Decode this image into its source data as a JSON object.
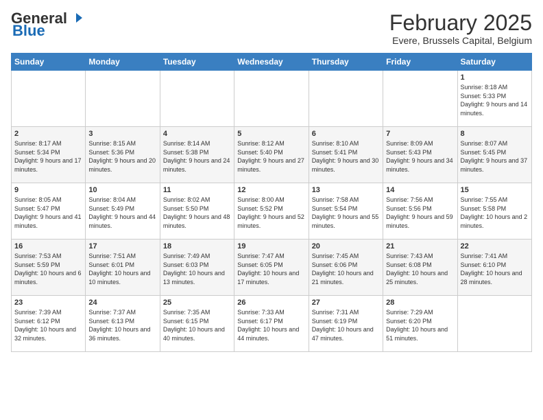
{
  "logo": {
    "general": "General",
    "blue": "Blue"
  },
  "header": {
    "month": "February 2025",
    "location": "Evere, Brussels Capital, Belgium"
  },
  "weekdays": [
    "Sunday",
    "Monday",
    "Tuesday",
    "Wednesday",
    "Thursday",
    "Friday",
    "Saturday"
  ],
  "weeks": [
    [
      {
        "day": "",
        "info": ""
      },
      {
        "day": "",
        "info": ""
      },
      {
        "day": "",
        "info": ""
      },
      {
        "day": "",
        "info": ""
      },
      {
        "day": "",
        "info": ""
      },
      {
        "day": "",
        "info": ""
      },
      {
        "day": "1",
        "info": "Sunrise: 8:18 AM\nSunset: 5:33 PM\nDaylight: 9 hours and 14 minutes."
      }
    ],
    [
      {
        "day": "2",
        "info": "Sunrise: 8:17 AM\nSunset: 5:34 PM\nDaylight: 9 hours and 17 minutes."
      },
      {
        "day": "3",
        "info": "Sunrise: 8:15 AM\nSunset: 5:36 PM\nDaylight: 9 hours and 20 minutes."
      },
      {
        "day": "4",
        "info": "Sunrise: 8:14 AM\nSunset: 5:38 PM\nDaylight: 9 hours and 24 minutes."
      },
      {
        "day": "5",
        "info": "Sunrise: 8:12 AM\nSunset: 5:40 PM\nDaylight: 9 hours and 27 minutes."
      },
      {
        "day": "6",
        "info": "Sunrise: 8:10 AM\nSunset: 5:41 PM\nDaylight: 9 hours and 30 minutes."
      },
      {
        "day": "7",
        "info": "Sunrise: 8:09 AM\nSunset: 5:43 PM\nDaylight: 9 hours and 34 minutes."
      },
      {
        "day": "8",
        "info": "Sunrise: 8:07 AM\nSunset: 5:45 PM\nDaylight: 9 hours and 37 minutes."
      }
    ],
    [
      {
        "day": "9",
        "info": "Sunrise: 8:05 AM\nSunset: 5:47 PM\nDaylight: 9 hours and 41 minutes."
      },
      {
        "day": "10",
        "info": "Sunrise: 8:04 AM\nSunset: 5:49 PM\nDaylight: 9 hours and 44 minutes."
      },
      {
        "day": "11",
        "info": "Sunrise: 8:02 AM\nSunset: 5:50 PM\nDaylight: 9 hours and 48 minutes."
      },
      {
        "day": "12",
        "info": "Sunrise: 8:00 AM\nSunset: 5:52 PM\nDaylight: 9 hours and 52 minutes."
      },
      {
        "day": "13",
        "info": "Sunrise: 7:58 AM\nSunset: 5:54 PM\nDaylight: 9 hours and 55 minutes."
      },
      {
        "day": "14",
        "info": "Sunrise: 7:56 AM\nSunset: 5:56 PM\nDaylight: 9 hours and 59 minutes."
      },
      {
        "day": "15",
        "info": "Sunrise: 7:55 AM\nSunset: 5:58 PM\nDaylight: 10 hours and 2 minutes."
      }
    ],
    [
      {
        "day": "16",
        "info": "Sunrise: 7:53 AM\nSunset: 5:59 PM\nDaylight: 10 hours and 6 minutes."
      },
      {
        "day": "17",
        "info": "Sunrise: 7:51 AM\nSunset: 6:01 PM\nDaylight: 10 hours and 10 minutes."
      },
      {
        "day": "18",
        "info": "Sunrise: 7:49 AM\nSunset: 6:03 PM\nDaylight: 10 hours and 13 minutes."
      },
      {
        "day": "19",
        "info": "Sunrise: 7:47 AM\nSunset: 6:05 PM\nDaylight: 10 hours and 17 minutes."
      },
      {
        "day": "20",
        "info": "Sunrise: 7:45 AM\nSunset: 6:06 PM\nDaylight: 10 hours and 21 minutes."
      },
      {
        "day": "21",
        "info": "Sunrise: 7:43 AM\nSunset: 6:08 PM\nDaylight: 10 hours and 25 minutes."
      },
      {
        "day": "22",
        "info": "Sunrise: 7:41 AM\nSunset: 6:10 PM\nDaylight: 10 hours and 28 minutes."
      }
    ],
    [
      {
        "day": "23",
        "info": "Sunrise: 7:39 AM\nSunset: 6:12 PM\nDaylight: 10 hours and 32 minutes."
      },
      {
        "day": "24",
        "info": "Sunrise: 7:37 AM\nSunset: 6:13 PM\nDaylight: 10 hours and 36 minutes."
      },
      {
        "day": "25",
        "info": "Sunrise: 7:35 AM\nSunset: 6:15 PM\nDaylight: 10 hours and 40 minutes."
      },
      {
        "day": "26",
        "info": "Sunrise: 7:33 AM\nSunset: 6:17 PM\nDaylight: 10 hours and 44 minutes."
      },
      {
        "day": "27",
        "info": "Sunrise: 7:31 AM\nSunset: 6:19 PM\nDaylight: 10 hours and 47 minutes."
      },
      {
        "day": "28",
        "info": "Sunrise: 7:29 AM\nSunset: 6:20 PM\nDaylight: 10 hours and 51 minutes."
      },
      {
        "day": "",
        "info": ""
      }
    ]
  ]
}
